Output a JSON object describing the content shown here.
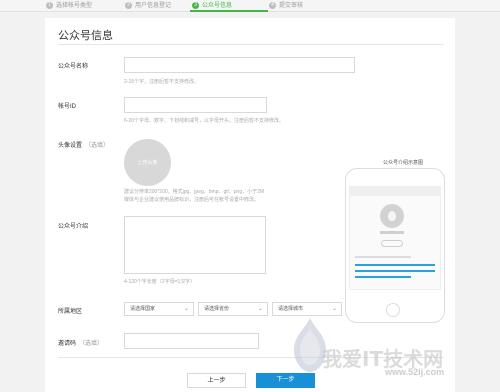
{
  "steps": [
    {
      "num": "1",
      "label": "选择帐号类型",
      "active": false
    },
    {
      "num": "2",
      "label": "用户信息登记",
      "active": false
    },
    {
      "num": "3",
      "label": "公众号信息",
      "active": true
    },
    {
      "num": "4",
      "label": "提交审核",
      "active": false
    }
  ],
  "page_title": "公众号信息",
  "fields": {
    "account_name": {
      "label": "公众号名称",
      "value": "",
      "hint": "2-15个字，注册后暂不支持修改。"
    },
    "account_id": {
      "label": "帐号ID",
      "value": "",
      "hint": "6-20个字母、数字、下划线和减号，以字母开头，注册后暂不支持修改。"
    },
    "avatar": {
      "label": "头像设置",
      "optional": "（选填）",
      "button": "上传头像",
      "hint_line1": "建议分辨率200*200，格式jpg、jpeg、bmp、gif、png，小于2M",
      "hint_line2": "媒体与企业建议使用品牌标识，注册后可在帐号设置中修改。"
    },
    "intro": {
      "label": "公众号介绍",
      "value": "",
      "hint": "4-120个字长度（2字母=1汉字）"
    },
    "region": {
      "label": "所属地区",
      "country": "请选择国家",
      "province": "请选择省份",
      "city": "请选择城市"
    },
    "invite": {
      "label": "邀请码",
      "optional": "（选填）",
      "value": ""
    }
  },
  "preview": {
    "title": "公众号介绍示意图"
  },
  "buttons": {
    "prev": "上一步",
    "next": "下一步"
  },
  "watermark": {
    "text": "我爱IT技术网",
    "url": "www.52ij.com"
  },
  "colors": {
    "accent": "#44b549",
    "primary_button": "#1890d5",
    "phone_highlight": "#2aa3dc"
  }
}
